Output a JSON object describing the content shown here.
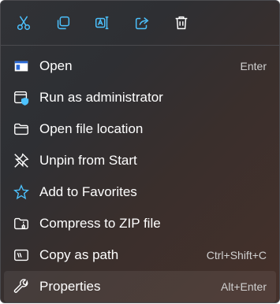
{
  "toolbar": {
    "items": [
      {
        "name": "cut",
        "icon": "scissors-icon"
      },
      {
        "name": "copy",
        "icon": "copy-icon"
      },
      {
        "name": "rename",
        "icon": "rename-icon"
      },
      {
        "name": "share",
        "icon": "share-icon"
      },
      {
        "name": "delete",
        "icon": "trash-icon"
      }
    ]
  },
  "menu": {
    "items": [
      {
        "label": "Open",
        "shortcut": "Enter",
        "icon": "app-window-icon"
      },
      {
        "label": "Run as administrator",
        "shortcut": "",
        "icon": "shield-window-icon"
      },
      {
        "label": "Open file location",
        "shortcut": "",
        "icon": "folder-icon"
      },
      {
        "label": "Unpin from Start",
        "shortcut": "",
        "icon": "unpin-icon"
      },
      {
        "label": "Add to Favorites",
        "shortcut": "",
        "icon": "star-icon"
      },
      {
        "label": "Compress to ZIP file",
        "shortcut": "",
        "icon": "zip-icon"
      },
      {
        "label": "Copy as path",
        "shortcut": "Ctrl+Shift+C",
        "icon": "path-icon"
      },
      {
        "label": "Properties",
        "shortcut": "Alt+Enter",
        "icon": "wrench-icon"
      }
    ]
  },
  "colors": {
    "accent": "#4cc2ff",
    "text": "#ffffff",
    "shortcut": "#d0d0d0"
  }
}
